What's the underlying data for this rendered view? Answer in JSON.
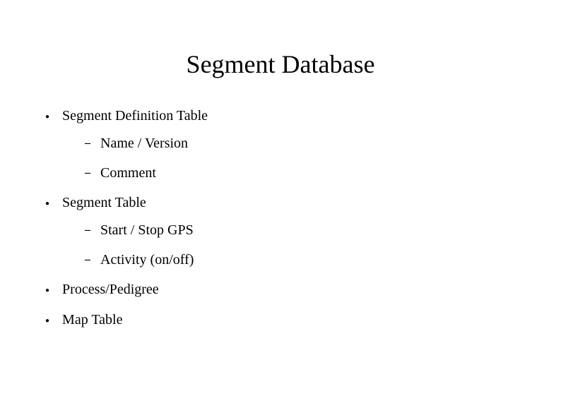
{
  "title": "Segment Database",
  "items": [
    {
      "text": "Segment Definition Table",
      "subitems": [
        "Name / Version",
        "Comment"
      ]
    },
    {
      "text": "Segment Table",
      "subitems": [
        "Start / Stop GPS",
        "Activity (on/off)"
      ]
    },
    {
      "text": "Process/Pedigree",
      "subitems": []
    },
    {
      "text": "Map Table",
      "subitems": []
    }
  ]
}
